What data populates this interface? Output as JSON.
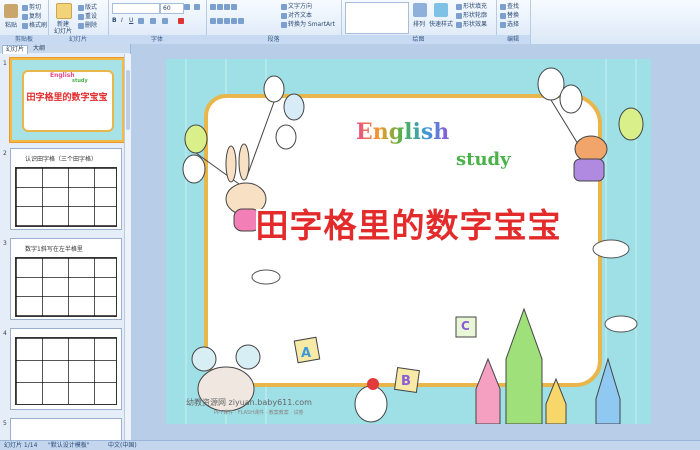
{
  "ribbon": {
    "clipboard": {
      "paste": "粘贴",
      "cut": "剪切",
      "copy": "复制",
      "format_painter": "格式刷",
      "label": "剪贴板"
    },
    "slides": {
      "new_slide": "新建",
      "new_slide_2": "幻灯片",
      "layout": "版式",
      "reset": "重设",
      "delete": "删除",
      "label": "幻灯片"
    },
    "font": {
      "size": "60",
      "label": "字体"
    },
    "paragraph": {
      "text_direction": "文字方向",
      "align_text": "对齐文本",
      "smartart": "转换为 SmartArt",
      "label": "段落"
    },
    "drawing": {
      "arrange": "排列",
      "quick_styles": "快速样式",
      "shape_fill": "形状填充",
      "shape_outline": "形状轮廓",
      "shape_effects": "形状效果",
      "label": "绘图"
    },
    "editing": {
      "find": "查找",
      "replace": "替换",
      "select": "选择",
      "label": "编辑"
    }
  },
  "panel": {
    "tabs": [
      "幻灯片",
      "大纲"
    ],
    "thumbs": [
      {
        "num": "1",
        "title": "田字格里的数字宝宝"
      },
      {
        "num": "2",
        "title": "认识田字格（三个田字格）"
      },
      {
        "num": "3",
        "title": "数字1斜写在左半格里"
      },
      {
        "num": "4",
        "title": ""
      },
      {
        "num": "5",
        "title": ""
      }
    ]
  },
  "slide": {
    "english": "English",
    "study": "study",
    "title": "田字格里的数字宝宝",
    "watermark": "幼教资源网 ziyuan.baby611.com",
    "watermark_sub": "PPT课件 · FLASH课件 · 教案教案 · 试卷",
    "letters": [
      "A",
      "B",
      "C"
    ]
  },
  "status": {
    "slide_of": "幻灯片 1/14",
    "theme": "\"默认设计模板\"",
    "lang": "中文(中国)"
  },
  "colors": {
    "english_letters": [
      "#e84b8a",
      "#f39a2a",
      "#4bb24a",
      "#3c9ad6",
      "#8a5bd6",
      "#e84b4b",
      "#f2c12e"
    ]
  }
}
